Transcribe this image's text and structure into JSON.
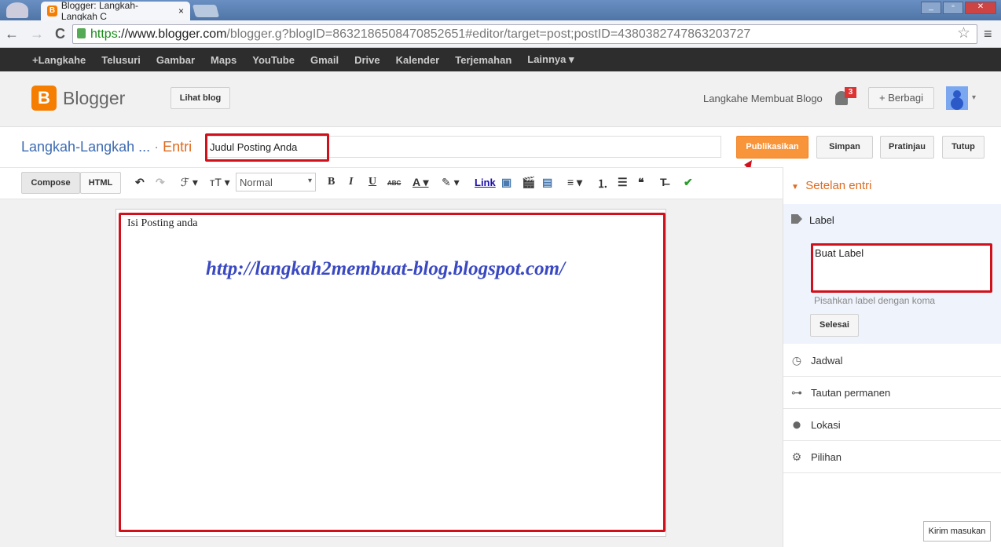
{
  "browser": {
    "tab_title": "Blogger: Langkah-Langkah C",
    "tab_close": "×",
    "url_scheme": "https",
    "url_host": "://www.blogger.com",
    "url_path": "/blogger.g?blogID=8632186508470852651#editor/target=post;postID=4380382747863203727",
    "nav": {
      "back": "←",
      "forward": "→",
      "reload": "C"
    },
    "star": "☆",
    "menu": "≡"
  },
  "gbar": [
    "+Langkahe",
    "Telusuri",
    "Gambar",
    "Maps",
    "YouTube",
    "Gmail",
    "Drive",
    "Kalender",
    "Terjemahan",
    "Lainnya ▾"
  ],
  "header": {
    "logo_letter": "B",
    "logo_text": "Blogger",
    "view_blog": "Lihat blog",
    "blog_name": "Langkahe Membuat Blogo",
    "notifications": "3",
    "share": "+ Berbagi",
    "avatar_caret": "▾"
  },
  "editor": {
    "breadcrumb": "Langkah-Langkah ...",
    "breadcrumb_sep": " · ",
    "breadcrumb_section": "Entri",
    "title_value": "Judul Posting Anda",
    "buttons": {
      "publish": "Publikasikan",
      "save": "Simpan",
      "preview": "Pratinjau",
      "close": "Tutup"
    },
    "modes": {
      "compose": "Compose",
      "html": "HTML"
    },
    "toolbar": {
      "undo": "↶",
      "redo": "↷",
      "font": "ℱ ▾",
      "size": "тT ▾",
      "format": "Normal",
      "format_caret": "▾",
      "bold": "B",
      "italic": "I",
      "underline": "U",
      "strike": "ABC",
      "textcolor": "A ▾",
      "highlight": "✎ ▾",
      "link": "Link",
      "image": "▣",
      "video": "🎬",
      "jump": "▤",
      "align": "≡ ▾",
      "ol": "⒈",
      "ul": "☰",
      "quote": "❝",
      "clear": "T̶",
      "spell": "✔"
    },
    "body_text": "Isi Posting anda",
    "watermark": "http://langkah2membuat-blog.blogspot.com/"
  },
  "sidebar": {
    "heading": "Setelan entri",
    "label_title": "Label",
    "label_value": "Buat Label",
    "label_hint": "Pisahkan label dengan koma",
    "done": "Selesai",
    "items": [
      {
        "icon": "clock-icon",
        "glyph": "◷",
        "label": "Jadwal"
      },
      {
        "icon": "link-icon",
        "glyph": "⊶",
        "label": "Tautan permanen"
      },
      {
        "icon": "location-icon",
        "glyph": "⬤",
        "label": "Lokasi"
      },
      {
        "icon": "gear-icon",
        "glyph": "⚙",
        "label": "Pilihan"
      }
    ]
  },
  "feedback": "Kirim masukan",
  "colors": {
    "accent": "#f57d00",
    "publish": "#f8953a",
    "link": "#3d6bb3",
    "annotation": "#d0101a"
  }
}
